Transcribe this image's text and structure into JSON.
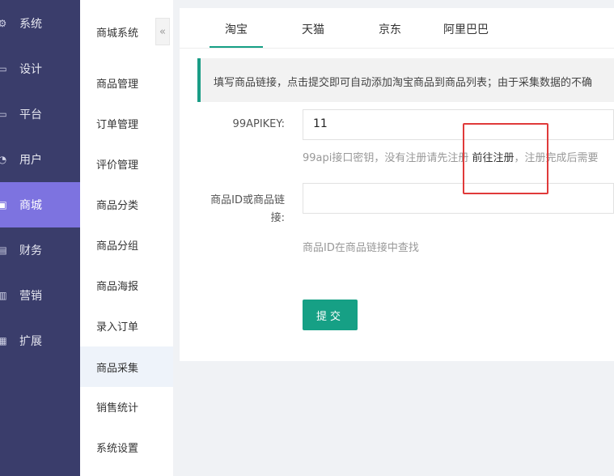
{
  "nav1": {
    "items": [
      {
        "label": "系统",
        "icon": "gear-icon"
      },
      {
        "label": "设计",
        "icon": "monitor-icon"
      },
      {
        "label": "平台",
        "icon": "monitor-icon"
      },
      {
        "label": "用户",
        "icon": "user-icon"
      },
      {
        "label": "商城",
        "icon": "cart-icon"
      },
      {
        "label": "财务",
        "icon": "wallet-icon"
      },
      {
        "label": "营销",
        "icon": "chart-icon"
      },
      {
        "label": "扩展",
        "icon": "grid-icon"
      }
    ]
  },
  "nav2": {
    "title": "商城系统",
    "collapse": "«",
    "items": [
      "商品管理",
      "订单管理",
      "评价管理",
      "商品分类",
      "商品分组",
      "商品海报",
      "录入订单",
      "商品采集",
      "销售统计",
      "系统设置"
    ]
  },
  "tabs": [
    "淘宝",
    "天猫",
    "京东",
    "阿里巴巴"
  ],
  "notice": "填写商品链接，点击提交即可自动添加淘宝商品到商品列表；由于采集数据的不确",
  "form": {
    "apikey_label": "99APIKEY:",
    "apikey_value": "11",
    "apikey_hint_pre": "99api接口密钥，没有注册请先注册 ",
    "apikey_hint_link": "前往注册",
    "apikey_hint_post": "，注册完成后需要",
    "goods_label_1": "商品ID或商品链",
    "goods_label_2": "接:",
    "goods_hint": "商品ID在商品链接中查找",
    "submit": "提交"
  },
  "colors": {
    "sidebar": "#3a3d6b",
    "active": "#7d73e0",
    "accent": "#16a085",
    "highlight": "#e03a3a"
  }
}
